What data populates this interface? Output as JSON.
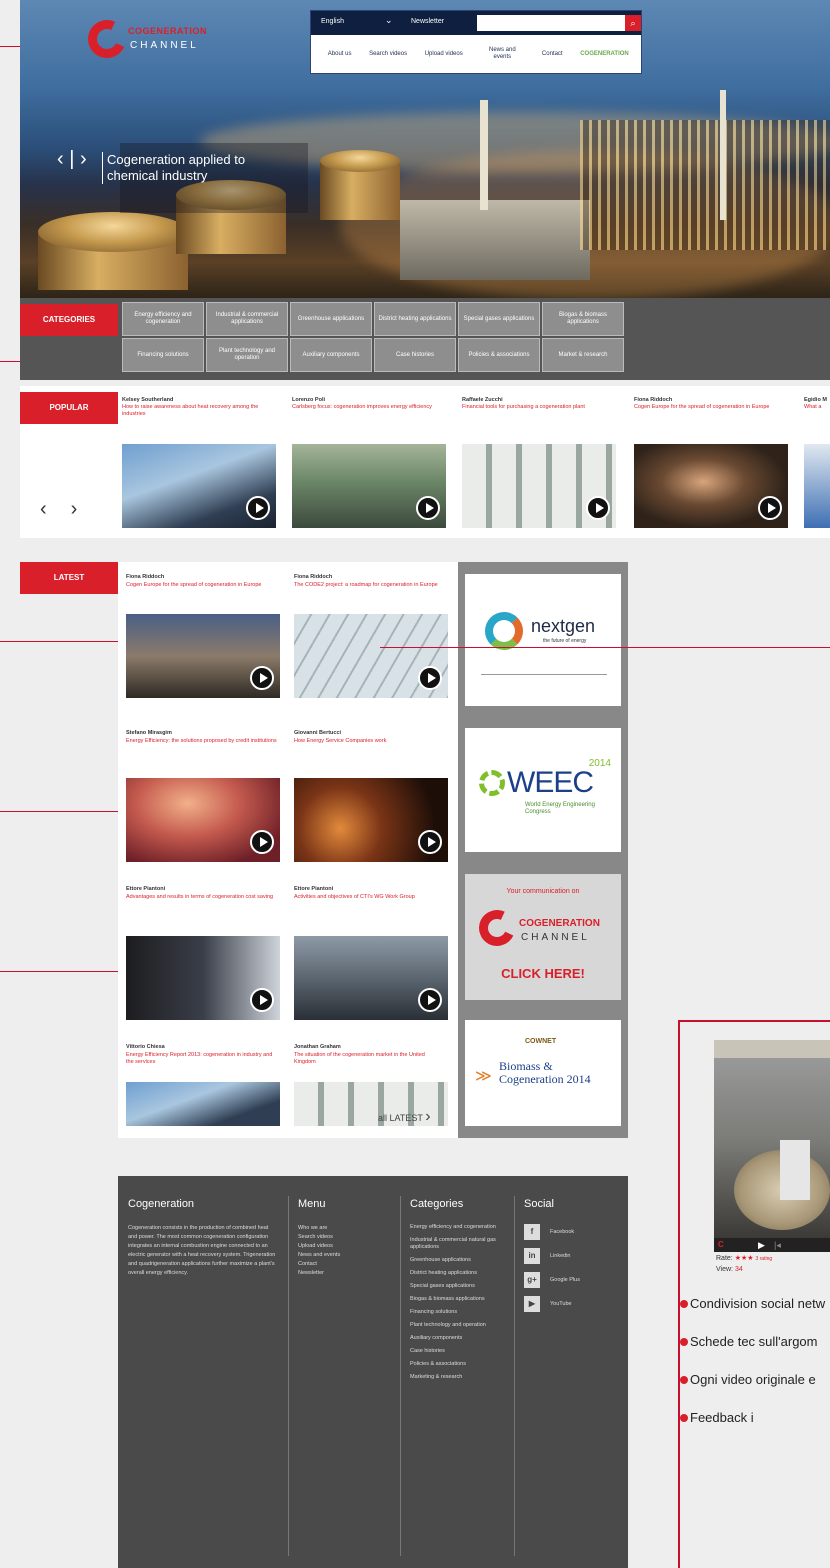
{
  "header": {
    "brand_top": "COGENERATION",
    "brand_bottom": "CHANNEL",
    "language": "English",
    "newsletter": "Newsletter",
    "search_placeholder": "",
    "nav": [
      "About us",
      "Search videos",
      "Upload videos",
      "News and events",
      "Contact",
      "COGENERATION"
    ],
    "hero_caption": "Cogeneration applied to chemical industry"
  },
  "categories": {
    "label": "CATEGORIES",
    "items": [
      "Energy efficiency and cogeneration",
      "Industrial & commercial applications",
      "Greenhouse applications",
      "District heating applications",
      "Special gases applications",
      "Biogas & biomass applications",
      "Financing solutions",
      "Plant technology and operation",
      "Auxiliary components",
      "Case histories",
      "Policies & associations",
      "Market & research"
    ]
  },
  "popular": {
    "label": "POPULAR",
    "items": [
      {
        "author": "Kelsey Southerland",
        "title": "How to raise awareness about heat recovery among the industries"
      },
      {
        "author": "Lorenzo Poli",
        "title": "Carlsberg focus: cogeneration improves energy efficiency"
      },
      {
        "author": "Raffaele Zucchi",
        "title": "Financial tools for purchasing a cogeneration plant"
      },
      {
        "author": "Fiona Riddoch",
        "title": "Cogen Europe for the spread of cogeneration in Europe"
      },
      {
        "author": "Egidio M",
        "title": "What a"
      }
    ]
  },
  "latest": {
    "label": "LATEST",
    "items": [
      {
        "author": "Fiona Riddoch",
        "title": "Cogen Europe for the spread of cogeneration in Europe"
      },
      {
        "author": "Fiona Riddoch",
        "title": "The CODE2 project: a roadmap for cogeneration in Europe"
      },
      {
        "author": "Stefano Mirasgim",
        "title": "Energy Efficiency: the solutions proposed by credit institutions"
      },
      {
        "author": "Giovanni Bertucci",
        "title": "How Energy Service Companies work"
      },
      {
        "author": "Ettore Piantoni",
        "title": "Advantages and results in terms of cogeneration cost saving"
      },
      {
        "author": "Ettore Piantoni",
        "title": "Activities and objectives of CTI's WG Work Group"
      },
      {
        "author": "Vittorio Chiesa",
        "title": "Energy Efficiency Report 2013: cogeneration in industry and the services"
      },
      {
        "author": "Jonathan Graham",
        "title": "The situation of the cogeneration market in the United Kingdom"
      }
    ],
    "all_link": "all LATEST"
  },
  "ads": {
    "nextgen_title": "nextgen",
    "nextgen_sub": "the future of energy",
    "weec_year": "2014",
    "weec_title": "WEEC",
    "weec_sub": "World Energy Engineering Congress",
    "promo_top": "Your communication on",
    "promo_brand_top": "COGENERATION",
    "promo_brand_bottom": "CHANNEL",
    "promo_cta": "CLICK HERE!",
    "biomass_org": "COWNET",
    "biomass_title": "Biomass & Cogeneration 2014"
  },
  "footer": {
    "about_title": "Cogeneration",
    "about_text": "Cogeneration consists in the production of combined heat and power. The most common cogeneration configuration integrates an internal combustion engine connected to an electric generator with a heat recovery system. Trigeneration and quadrigeneration applications further maximize a plant's overall energy efficiency.",
    "menu_title": "Menu",
    "menu": [
      "Who we are",
      "Search videos",
      "Upload videos",
      "News and events",
      "Contact",
      "Newsletter"
    ],
    "categories_title": "Categories",
    "categories": [
      "Energy efficiency and cogeneration",
      "Industrial & commercial natural gas applications",
      "Greenhouse applications",
      "District heating applications",
      "Special gases applications",
      "Biogas & biomass applications",
      "Financing solutions",
      "Plant technology and operation",
      "Auxiliary components",
      "Case histories",
      "Policies & associations",
      "Marketing & research"
    ],
    "social_title": "Social",
    "social": [
      "Facebook",
      "Linkedin",
      "Google Plus",
      "YouTube"
    ]
  },
  "preview": {
    "rate_label": "Rate:",
    "rate_stars": "★★★",
    "rate_count": "3 rating",
    "views_label": "View:",
    "views_value": "34",
    "bullets": [
      "Condivision social netw",
      "Schede tec sull'argom",
      "Ogni video originale e",
      "Feedback i"
    ]
  },
  "colors": {
    "accent": "#d9202a",
    "navy": "#0f1f3f",
    "dark": "#4a4a4a"
  }
}
